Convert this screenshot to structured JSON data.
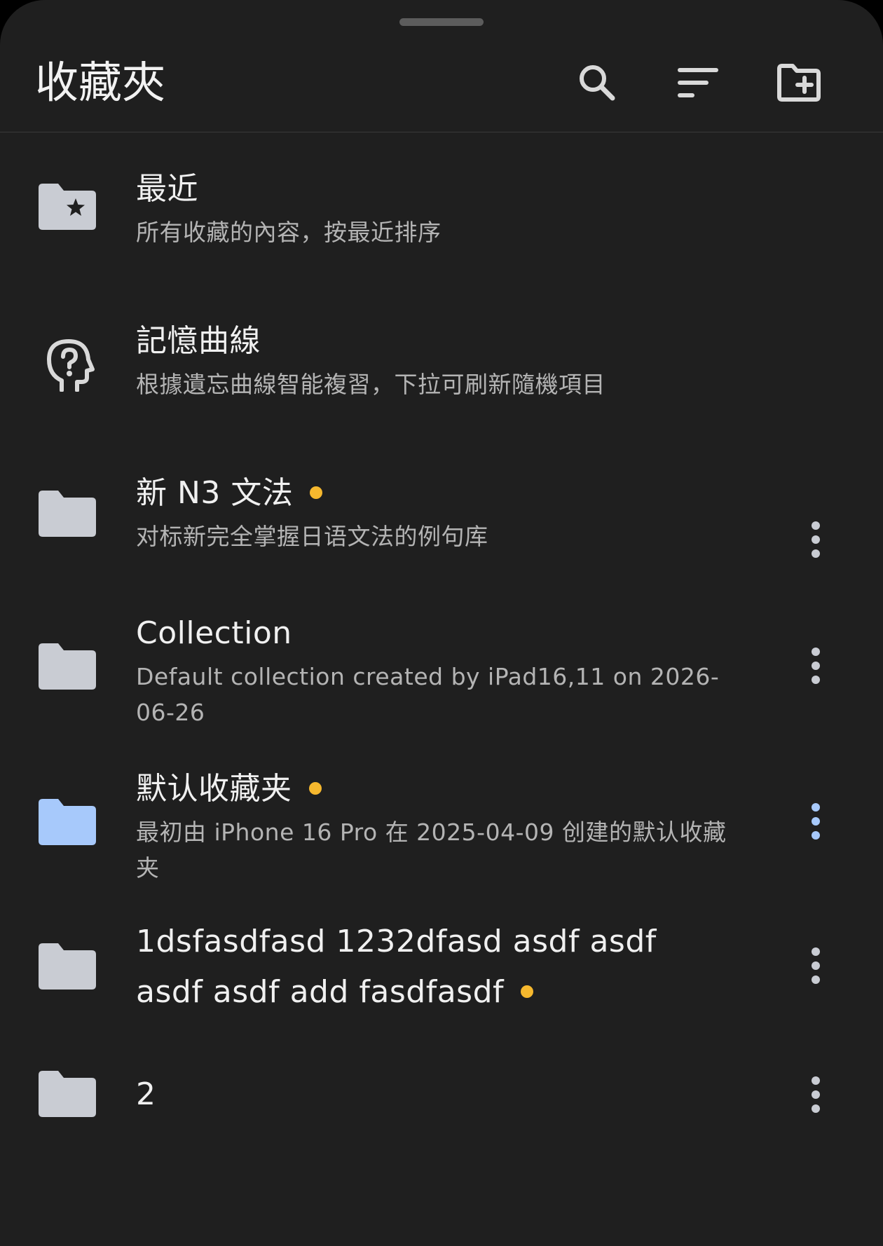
{
  "header": {
    "title": "收藏夾"
  },
  "icons": {
    "search": "search-icon",
    "sort": "sort-icon",
    "new_folder": "folder-add-icon"
  },
  "colors": {
    "background": "#1f1f1f",
    "accent_dot": "#f6b82e",
    "selected_folder": "#a7c9fb",
    "folder_default": "#c9ccd3"
  },
  "items": [
    {
      "title": "最近",
      "subtitle": "所有收藏的內容，按最近排序",
      "icon": "folder-star-icon",
      "has_dot": false,
      "has_menu": false
    },
    {
      "title": "記憶曲線",
      "subtitle": "根據遺忘曲線智能複習，下拉可刷新隨機項目",
      "icon": "head-question-icon",
      "has_dot": false,
      "has_menu": false
    },
    {
      "title": "新 N3 文法",
      "subtitle": "对标新完全掌握日语文法的例句库",
      "icon": "folder-icon",
      "has_dot": true,
      "has_menu": true
    },
    {
      "title": "Collection",
      "subtitle": "Default collection created by iPad16,11 on 2026-06-26",
      "icon": "folder-icon",
      "has_dot": false,
      "has_menu": true
    },
    {
      "title": "默认收藏夹",
      "subtitle": "最初由 iPhone 16 Pro 在 2025-04-09 创建的默认收藏夹",
      "icon": "folder-icon",
      "has_dot": true,
      "has_menu": true,
      "selected": true
    },
    {
      "title": "1dsfasdfasd 1232dfasd asdf asdf asdf asdf add fasdfasdf",
      "subtitle": "",
      "icon": "folder-icon",
      "has_dot": true,
      "has_menu": true
    },
    {
      "title": "2",
      "subtitle": "",
      "icon": "folder-icon",
      "has_dot": false,
      "has_menu": true
    }
  ]
}
